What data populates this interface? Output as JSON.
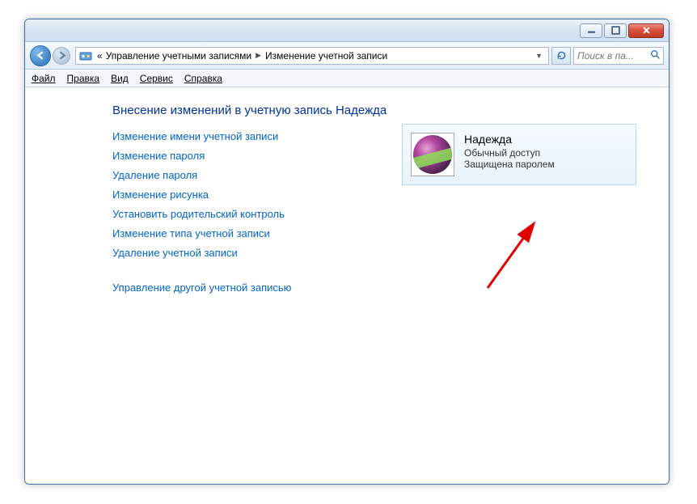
{
  "nav": {
    "crumb_prefix": "«",
    "crumb1": "Управление учетными записями",
    "crumb2": "Изменение учетной записи"
  },
  "search": {
    "placeholder": "Поиск в па..."
  },
  "menu": {
    "file": "Файл",
    "edit": "Правка",
    "view": "Вид",
    "tools": "Сервис",
    "help": "Справка"
  },
  "content": {
    "heading": "Внесение изменений в учетную запись Надежда",
    "links": [
      "Изменение имени учетной записи",
      "Изменение пароля",
      "Удаление пароля",
      "Изменение рисунка",
      "Установить родительский контроль",
      "Изменение типа учетной записи",
      "Удаление учетной записи"
    ],
    "manage_other": "Управление другой учетной записью"
  },
  "user": {
    "name": "Надежда",
    "type": "Обычный доступ",
    "protection": "Защищена паролем"
  }
}
